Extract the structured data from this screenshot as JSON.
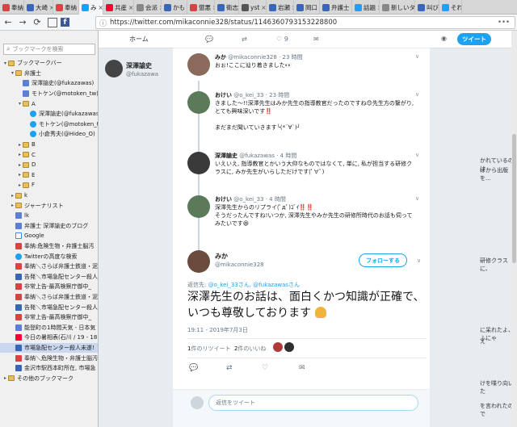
{
  "tabs": [
    {
      "label": "奉納",
      "color": "#d84444"
    },
    {
      "label": "大崎",
      "color": "#3a66b8"
    },
    {
      "label": "奉納",
      "color": "#d84444"
    },
    {
      "label": "み",
      "color": "#1da1f2",
      "active": true
    },
    {
      "label": "共産",
      "color": "#ff0033"
    },
    {
      "label": "会派",
      "color": "#888888"
    },
    {
      "label": "かも",
      "color": "#3a66b8"
    },
    {
      "label": "懲悪",
      "color": "#d84444"
    },
    {
      "label": "衛志",
      "color": "#3a66b8"
    },
    {
      "label": "yst",
      "color": "#555555"
    },
    {
      "label": "岩瀬",
      "color": "#3a66b8"
    },
    {
      "label": "岡口",
      "color": "#3a66b8"
    },
    {
      "label": "弁護士",
      "color": "#3a66b8"
    },
    {
      "label": "話題",
      "color": "#1da1f2"
    },
    {
      "label": "新しいタブ",
      "color": "#888888"
    },
    {
      "label": "叫び",
      "color": "#3a66b8"
    },
    {
      "label": "それ",
      "color": "#1da1f2"
    }
  ],
  "nav": {
    "back": "←",
    "forward": "→",
    "reload": "⟳",
    "fb": "f",
    "url": "https://twitter.com/mikaconnie328/status/1146360793153228800",
    "info_icon": "ⓘ",
    "more": "•••"
  },
  "sidebar": {
    "search_placeholder": "ブックマークを検索",
    "items": [
      {
        "label": "ブックマークバー",
        "icon": "folder",
        "indent": 0,
        "tw": "▾"
      },
      {
        "label": "弁護士",
        "icon": "folder",
        "indent": 1,
        "tw": "▾"
      },
      {
        "label": "深澤諭史(@fukazawas)",
        "icon": "fn",
        "indent": 2,
        "tw": ""
      },
      {
        "label": "モトケン(@motoken_tw)",
        "icon": "fn",
        "indent": 2,
        "tw": ""
      },
      {
        "label": "A",
        "icon": "folder",
        "indent": 2,
        "tw": "▾"
      },
      {
        "label": "深澤諭史(@fukazawas)",
        "icon": "twt",
        "indent": 3,
        "tw": ""
      },
      {
        "label": "モトケン(@motoken_tw)",
        "icon": "twt",
        "indent": 3,
        "tw": ""
      },
      {
        "label": "小倉秀夫(@Hideo_O)",
        "icon": "twt",
        "indent": 3,
        "tw": ""
      },
      {
        "label": "B",
        "icon": "folder",
        "indent": 2,
        "tw": "▸"
      },
      {
        "label": "C",
        "icon": "folder",
        "indent": 2,
        "tw": "▸"
      },
      {
        "label": "D",
        "icon": "folder",
        "indent": 2,
        "tw": "▸"
      },
      {
        "label": "E",
        "icon": "folder",
        "indent": 2,
        "tw": "▸"
      },
      {
        "label": "F",
        "icon": "folder",
        "indent": 2,
        "tw": "▸"
      },
      {
        "label": "k",
        "icon": "folder",
        "indent": 1,
        "tw": "▸"
      },
      {
        "label": "ジャーナリスト",
        "icon": "folder",
        "indent": 1,
        "tw": "▸"
      },
      {
        "label": "lk",
        "icon": "fn",
        "indent": 1,
        "tw": ""
      },
      {
        "label": "弁護士 深澤諭史のブログ",
        "icon": "fn",
        "indent": 1,
        "tw": ""
      },
      {
        "label": "Google",
        "icon": "g",
        "indent": 1,
        "tw": ""
      },
      {
        "label": "奉納:危険生物・弁護士脳汚",
        "icon": "red",
        "indent": 1,
        "tw": ""
      },
      {
        "label": "Twitterの高度な検索",
        "icon": "twt",
        "indent": 1,
        "tw": ""
      },
      {
        "label": "奉納＼さらば弁護士鉄道・泥",
        "icon": "red",
        "indent": 1,
        "tw": ""
      },
      {
        "label": "告発＼市場急配センター殺人",
        "icon": "blue",
        "indent": 1,
        "tw": ""
      },
      {
        "label": "非常上告-最高検察庁御中_",
        "icon": "red",
        "indent": 1,
        "tw": ""
      },
      {
        "label": "奉納＼さらば弁護士鉄道・泥",
        "icon": "red",
        "indent": 1,
        "tw": ""
      },
      {
        "label": "告発＼市場急配センター殺人",
        "icon": "blue",
        "indent": 1,
        "tw": ""
      },
      {
        "label": "非常上告-最高検察庁御中_",
        "icon": "red",
        "indent": 1,
        "tw": ""
      },
      {
        "label": "能登町の1時間天気 - 日本気",
        "icon": "fn",
        "indent": 1,
        "tw": ""
      },
      {
        "label": "今日の暑相表(石川 / 19 - 18",
        "icon": "yahoo",
        "indent": 1,
        "tw": ""
      },
      {
        "label": "市場急配センター殺人未遂!",
        "icon": "blue",
        "indent": 1,
        "tw": "",
        "selected": true
      },
      {
        "label": "奉納＼危険生物・弁護士脳汚",
        "icon": "red",
        "indent": 1,
        "tw": ""
      },
      {
        "label": "金沢市駅西本町所在, 市場急",
        "icon": "blue",
        "indent": 1,
        "tw": ""
      },
      {
        "label": "その他のブックマーク",
        "icon": "folder",
        "indent": 0,
        "tw": "▸"
      }
    ]
  },
  "twitter": {
    "home": "ホーム",
    "tweet_button": "ツイート",
    "bg_name": "深澤諭史",
    "bg_handle": "@fukazawa",
    "bg_right": [
      {
        "text": "かれているのは"
      },
      {
        "text": "ばから出版を..."
      },
      {
        "text": "研修クラスに、"
      },
      {
        "text": "に呆れたよ、ふにゃ"
      },
      {
        "text": "え"
      },
      {
        "text": "けを喋り向いた"
      },
      {
        "text": "を言われたので"
      }
    ],
    "top_stats": {
      "replies": "",
      "likes": "9"
    }
  },
  "replies": [
    {
      "name": "みか",
      "handle": "@mikaconnie328",
      "time": "23 時間",
      "text": "おぉ!ここに辿り着きました👀",
      "avatar_color": "#8a6a5a"
    },
    {
      "name": "おけい",
      "handle": "@o_kei_33",
      "time": "23 時間",
      "text": "きました〜!!深澤先生はみか先生の指導教官だったのですね😊先生方の繋がり,とても興味深いです‼️\n\nまだまだ聞いていきます╰(*´∀`)╯",
      "avatar_color": "#5a7a5a"
    },
    {
      "name": "深澤諭史",
      "handle": "@fukazawas",
      "time": "4 時間",
      "text": "いえいえ, 指導教官とかいう大仰なものではなくて, 単に, 私が担当する研修クラスに, みか先生がいらしただけです(ﾟ∀ﾟ)",
      "avatar_color": "#3a3a3a"
    },
    {
      "name": "おけい",
      "handle": "@o_kei_33",
      "time": "4 時間",
      "text": "深澤先生からのリプライ(ﾟдﾟ)ｺﾞｲ‼️‼️\nそうだったんですね!いつか, 深澤先生やみか先生の研修所時代のお話も伺ってみたいです😆",
      "avatar_color": "#5a7a5a"
    }
  ],
  "main_tweet": {
    "name": "みか",
    "handle": "@mikaconnie328",
    "follow_label": "フォローする",
    "reply_prefix": "返信先:",
    "reply_to": "@o_kei_33さん, @fukazawasさん",
    "text": "深澤先生のお話は、面白くかつ知識が正確で、いつも尊敬しております",
    "timestamp": "19:11 - 2019年7月3日",
    "retweets_num": "1",
    "retweets_label": "件のリツイート",
    "likes_num": "2",
    "likes_label": "件のいいね"
  },
  "compose": {
    "placeholder": "返信をツイート"
  }
}
